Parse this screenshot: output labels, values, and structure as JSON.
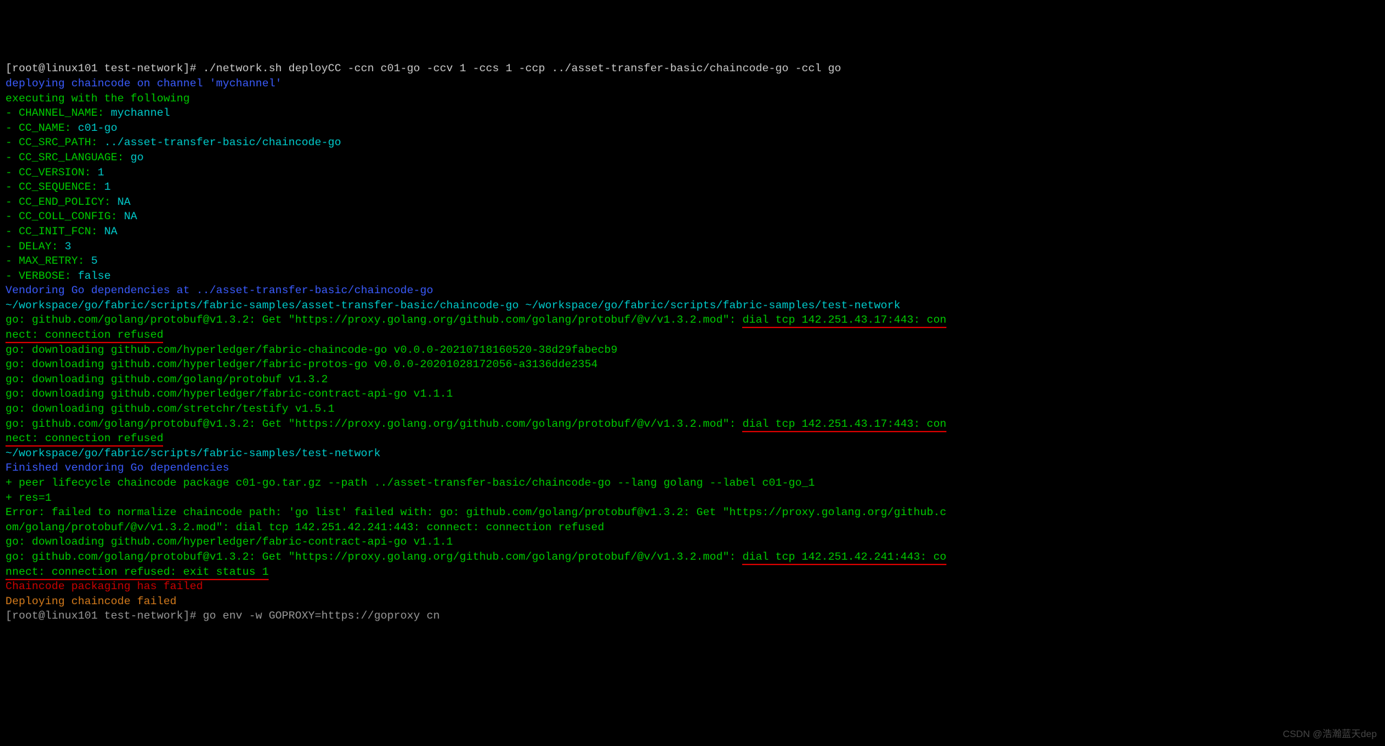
{
  "prompt1": "[root@linux101 test-network]# ",
  "cmd1": "./network.sh deployCC -ccn c01-go -ccv 1 -ccs 1 -ccp ../asset-transfer-basic/chaincode-go -ccl go",
  "deploying_line": "deploying chaincode on channel 'mychannel'",
  "executing_line": "executing with the following",
  "params": [
    {
      "dash": "- ",
      "key": "CHANNEL_NAME:",
      "val": " mychannel"
    },
    {
      "dash": "- ",
      "key": "CC_NAME:",
      "val": " c01-go"
    },
    {
      "dash": "- ",
      "key": "CC_SRC_PATH:",
      "val": " ../asset-transfer-basic/chaincode-go"
    },
    {
      "dash": "- ",
      "key": "CC_SRC_LANGUAGE:",
      "val": " go"
    },
    {
      "dash": "- ",
      "key": "CC_VERSION:",
      "val": " 1"
    },
    {
      "dash": "- ",
      "key": "CC_SEQUENCE:",
      "val": " 1"
    },
    {
      "dash": "- ",
      "key": "CC_END_POLICY:",
      "val": " NA"
    },
    {
      "dash": "- ",
      "key": "CC_COLL_CONFIG:",
      "val": " NA"
    },
    {
      "dash": "- ",
      "key": "CC_INIT_FCN:",
      "val": " NA"
    },
    {
      "dash": "- ",
      "key": "DELAY:",
      "val": " 3"
    },
    {
      "dash": "- ",
      "key": "MAX_RETRY:",
      "val": " 5"
    },
    {
      "dash": "- ",
      "key": "VERBOSE:",
      "val": " false"
    }
  ],
  "vendoring_line": "Vendoring Go dependencies at ../asset-transfer-basic/chaincode-go",
  "workspace_line": "~/workspace/go/fabric/scripts/fabric-samples/asset-transfer-basic/chaincode-go ~/workspace/go/fabric/scripts/fabric-samples/test-network",
  "err1_pre": "go: github.com/golang/protobuf@v1.3.2: Get \"https://proxy.golang.org/github.com/golang/protobuf/@v/v1.3.2.mod\": ",
  "err1_mid": "dial tcp 142.251.43.17:443: con",
  "err1_wrap": "nect: connection refused",
  "download_lines": [
    "go: downloading github.com/hyperledger/fabric-chaincode-go v0.0.0-20210718160520-38d29fabecb9",
    "go: downloading github.com/hyperledger/fabric-protos-go v0.0.0-20201028172056-a3136dde2354",
    "go: downloading github.com/golang/protobuf v1.3.2",
    "go: downloading github.com/hyperledger/fabric-contract-api-go v1.1.1",
    "go: downloading github.com/stretchr/testify v1.5.1"
  ],
  "err2_pre": "go: github.com/golang/protobuf@v1.3.2: Get \"https://proxy.golang.org/github.com/golang/protobuf/@v/v1.3.2.mod\": ",
  "err2_mid": "dial tcp 142.251.43.17:443: con",
  "err2_wrap": "nect: connection refused",
  "workspace_line2": "~/workspace/go/fabric/scripts/fabric-samples/test-network",
  "finished_vendoring": "Finished vendoring Go dependencies",
  "peer_line": "+ peer lifecycle chaincode package c01-go.tar.gz --path ../asset-transfer-basic/chaincode-go --lang golang --label c01-go_1",
  "res_line": "+ res=1",
  "error_normalize_1": "Error: failed to normalize chaincode path: 'go list' failed with: go: github.com/golang/protobuf@v1.3.2: Get \"https://proxy.golang.org/github.c",
  "error_normalize_2": "om/golang/protobuf/@v/v1.3.2.mod\": dial tcp 142.251.42.241:443: connect: connection refused",
  "download_line_late": "go: downloading github.com/hyperledger/fabric-contract-api-go v1.1.1",
  "err3_pre": "go: github.com/golang/protobuf@v1.3.2: Get \"https://proxy.golang.org/github.com/golang/protobuf/@v/v1.3.2.mod\": ",
  "err3_mid": "dial tcp 142.251.42.241:443: co",
  "err3_wrap": "nnect: connection refused: exit status 1",
  "packaging_failed": "Chaincode packaging has failed",
  "deploying_failed": "Deploying chaincode failed",
  "prompt2": "[root@linux101 test-network]# ",
  "cmd2": "go env -w GOPROXY=https://goproxy cn",
  "watermark": "CSDN @浩瀚蓝天dep"
}
